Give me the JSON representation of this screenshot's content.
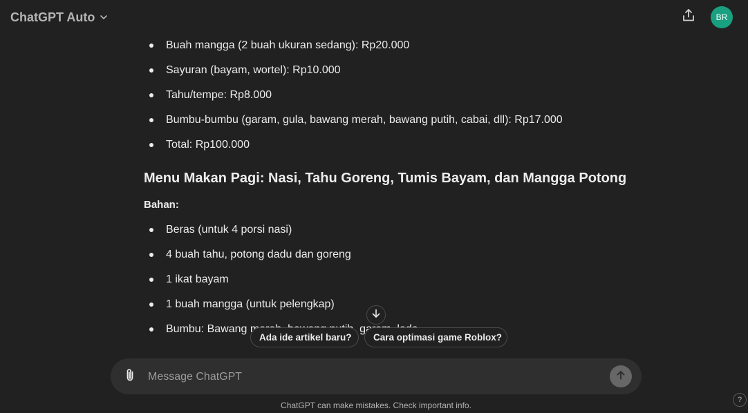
{
  "header": {
    "model_label": "ChatGPT Auto",
    "avatar_initials": "BR"
  },
  "message": {
    "list_top": [
      "Buah mangga (2 buah ukuran sedang): Rp20.000",
      "Sayuran (bayam, wortel): Rp10.000",
      "Tahu/tempe: Rp8.000",
      "Bumbu-bumbu (garam, gula, bawang merah, bawang putih, cabai, dll): Rp17.000",
      "Total: Rp100.000"
    ],
    "heading": "Menu Makan Pagi: Nasi, Tahu Goreng, Tumis Bayam, dan Mangga Potong",
    "ingredients_label": "Bahan:",
    "list_bottom": [
      "Beras (untuk 4 porsi nasi)",
      "4 buah tahu, potong dadu dan goreng",
      "1 ikat bayam",
      "1 buah mangga (untuk pelengkap)",
      "Bumbu: Bawang merah, bawang putih, garam, lada"
    ]
  },
  "suggestions": [
    "Ada ide artikel baru?",
    "Cara optimasi game Roblox?"
  ],
  "composer": {
    "placeholder": "Message ChatGPT"
  },
  "footer": {
    "disclaimer": "ChatGPT can make mistakes. Check important info.",
    "help_label": "?"
  },
  "icons": {
    "model_chevron": "chevron-down-icon",
    "share": "share-icon",
    "scroll": "arrow-down-icon",
    "attach": "paperclip-icon",
    "send": "arrow-up-icon"
  },
  "colors": {
    "background": "#212121",
    "composer": "#2f2f2f",
    "avatar": "#19a081",
    "text": "#ececec",
    "muted": "#b4b4b4"
  }
}
